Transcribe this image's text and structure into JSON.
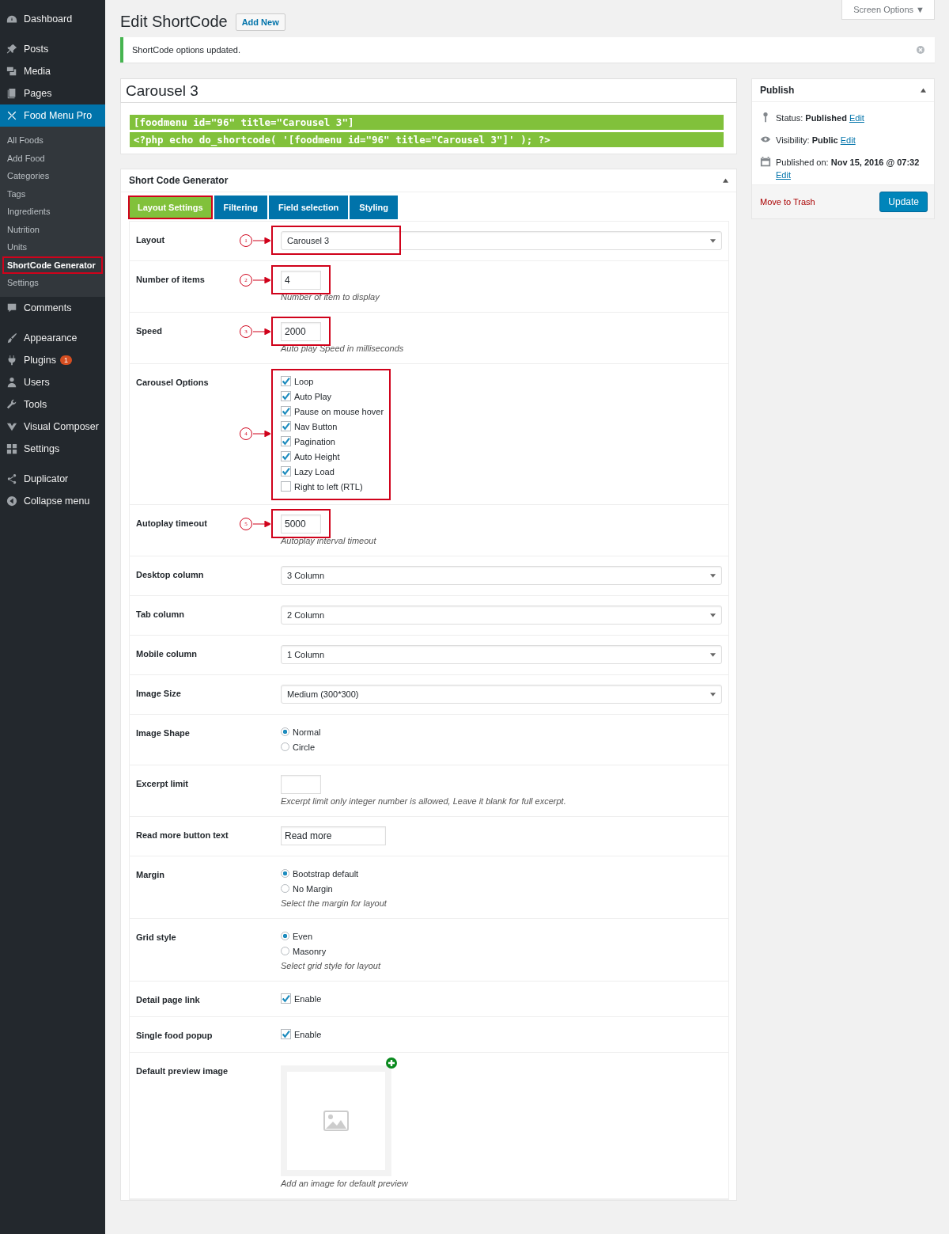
{
  "sidebar": {
    "groups": [
      {
        "items": [
          {
            "label": "Dashboard",
            "selected": false
          }
        ]
      },
      {
        "items": [
          {
            "label": "Posts",
            "selected": false
          },
          {
            "label": "Media",
            "selected": false
          },
          {
            "label": "Pages",
            "selected": false
          },
          {
            "label": "Food Menu Pro",
            "selected": true,
            "children": [
              {
                "label": "All Foods",
                "selected": false,
                "highlighted": false
              },
              {
                "label": "Add Food",
                "selected": false,
                "highlighted": false
              },
              {
                "label": "Categories",
                "selected": false,
                "highlighted": false
              },
              {
                "label": "Tags",
                "selected": false,
                "highlighted": false
              },
              {
                "label": "Ingredients",
                "selected": false,
                "highlighted": false
              },
              {
                "label": "Nutrition",
                "selected": false,
                "highlighted": false
              },
              {
                "label": "Units",
                "selected": false,
                "highlighted": false
              },
              {
                "label": "ShortCode Generator",
                "selected": true,
                "highlighted": true
              },
              {
                "label": "Settings",
                "selected": false,
                "highlighted": false
              }
            ]
          },
          {
            "label": "Comments",
            "selected": false
          }
        ]
      },
      {
        "items": [
          {
            "label": "Appearance",
            "selected": false
          },
          {
            "label": "Plugins",
            "selected": false,
            "badge": "1"
          },
          {
            "label": "Users",
            "selected": false
          },
          {
            "label": "Tools",
            "selected": false
          },
          {
            "label": "Visual Composer",
            "selected": false
          },
          {
            "label": "Settings",
            "selected": false
          }
        ]
      },
      {
        "items": [
          {
            "label": "Duplicator",
            "selected": false
          },
          {
            "label": "Collapse menu",
            "selected": false
          }
        ]
      }
    ]
  },
  "header": {
    "title": "Edit ShortCode",
    "add_new": "Add New",
    "screen_options": "Screen Options ▼",
    "notice": "ShortCode options updated."
  },
  "title_field": {
    "value": "Carousel 3"
  },
  "shortcodes": [
    "[foodmenu id=\"96\" title=\"Carousel 3\"]",
    "<?php echo do_shortcode( '[foodmenu id=\"96\" title=\"Carousel 3\"]' ); ?>"
  ],
  "generator": {
    "title": "Short Code Generator",
    "tabs": [
      {
        "label": "Layout Settings",
        "selected": true,
        "highlighted": true
      },
      {
        "label": "Filtering",
        "selected": false,
        "highlighted": false
      },
      {
        "label": "Field selection",
        "selected": false,
        "highlighted": false
      },
      {
        "label": "Styling",
        "selected": false,
        "highlighted": false
      }
    ],
    "rows": [
      {
        "kind": "select",
        "label": "Layout",
        "value": "Carousel 3",
        "annotation": "1"
      },
      {
        "kind": "number",
        "label": "Number of items",
        "value": "4",
        "hint": "Number of item to display",
        "annotation": "2"
      },
      {
        "kind": "number",
        "label": "Speed",
        "value": "2000",
        "hint": "Auto play Speed in milliseconds",
        "annotation": "3"
      },
      {
        "kind": "checkboxes",
        "label": "Carousel Options",
        "annotation": "4",
        "options": [
          {
            "label": "Loop",
            "checked": true
          },
          {
            "label": "Auto Play",
            "checked": true
          },
          {
            "label": "Pause on mouse hover",
            "checked": true
          },
          {
            "label": "Nav Button",
            "checked": true
          },
          {
            "label": "Pagination",
            "checked": true
          },
          {
            "label": "Auto Height",
            "checked": true
          },
          {
            "label": "Lazy Load",
            "checked": true
          },
          {
            "label": "Right to left (RTL)",
            "checked": false
          }
        ]
      },
      {
        "kind": "number",
        "label": "Autoplay timeout",
        "value": "5000",
        "hint": "Autoplay interval timeout",
        "annotation": "5"
      },
      {
        "kind": "select",
        "label": "Desktop column",
        "value": "3 Column"
      },
      {
        "kind": "select",
        "label": "Tab column",
        "value": "2 Column"
      },
      {
        "kind": "select",
        "label": "Mobile column",
        "value": "1 Column"
      },
      {
        "kind": "select",
        "label": "Image Size",
        "value": "Medium (300*300)"
      },
      {
        "kind": "radios",
        "label": "Image Shape",
        "options": [
          {
            "label": "Normal",
            "selected": true
          },
          {
            "label": "Circle",
            "selected": false
          }
        ]
      },
      {
        "kind": "number",
        "label": "Excerpt limit",
        "hint": "Excerpt limit only integer number is allowed, Leave it blank for full excerpt."
      },
      {
        "kind": "text",
        "label": "Read more button text",
        "value": "Read more"
      },
      {
        "kind": "radios",
        "label": "Margin",
        "options": [
          {
            "label": "Bootstrap default",
            "selected": true
          },
          {
            "label": "No Margin",
            "selected": false
          }
        ],
        "hint": "Select the margin for layout"
      },
      {
        "kind": "radios",
        "label": "Grid style",
        "options": [
          {
            "label": "Even",
            "selected": true
          },
          {
            "label": "Masonry",
            "selected": false
          }
        ],
        "hint": "Select grid style for layout"
      },
      {
        "kind": "checkbox",
        "label": "Detail page link",
        "option": {
          "label": "Enable",
          "checked": true
        }
      },
      {
        "kind": "checkbox",
        "label": "Single food popup",
        "option": {
          "label": "Enable",
          "checked": true
        }
      },
      {
        "kind": "image",
        "label": "Default preview image",
        "hint": "Add an image for default preview"
      }
    ]
  },
  "publish": {
    "title": "Publish",
    "lines": [
      {
        "label": "Status:",
        "value": "Published",
        "link": "Edit"
      },
      {
        "label": "Visibility:",
        "value": "Public",
        "link": "Edit"
      },
      {
        "label": "Published on:",
        "value": "Nov 15, 2016 @ 07:32",
        "link": "Edit"
      }
    ],
    "trash": "Move to Trash",
    "update": "Update"
  }
}
